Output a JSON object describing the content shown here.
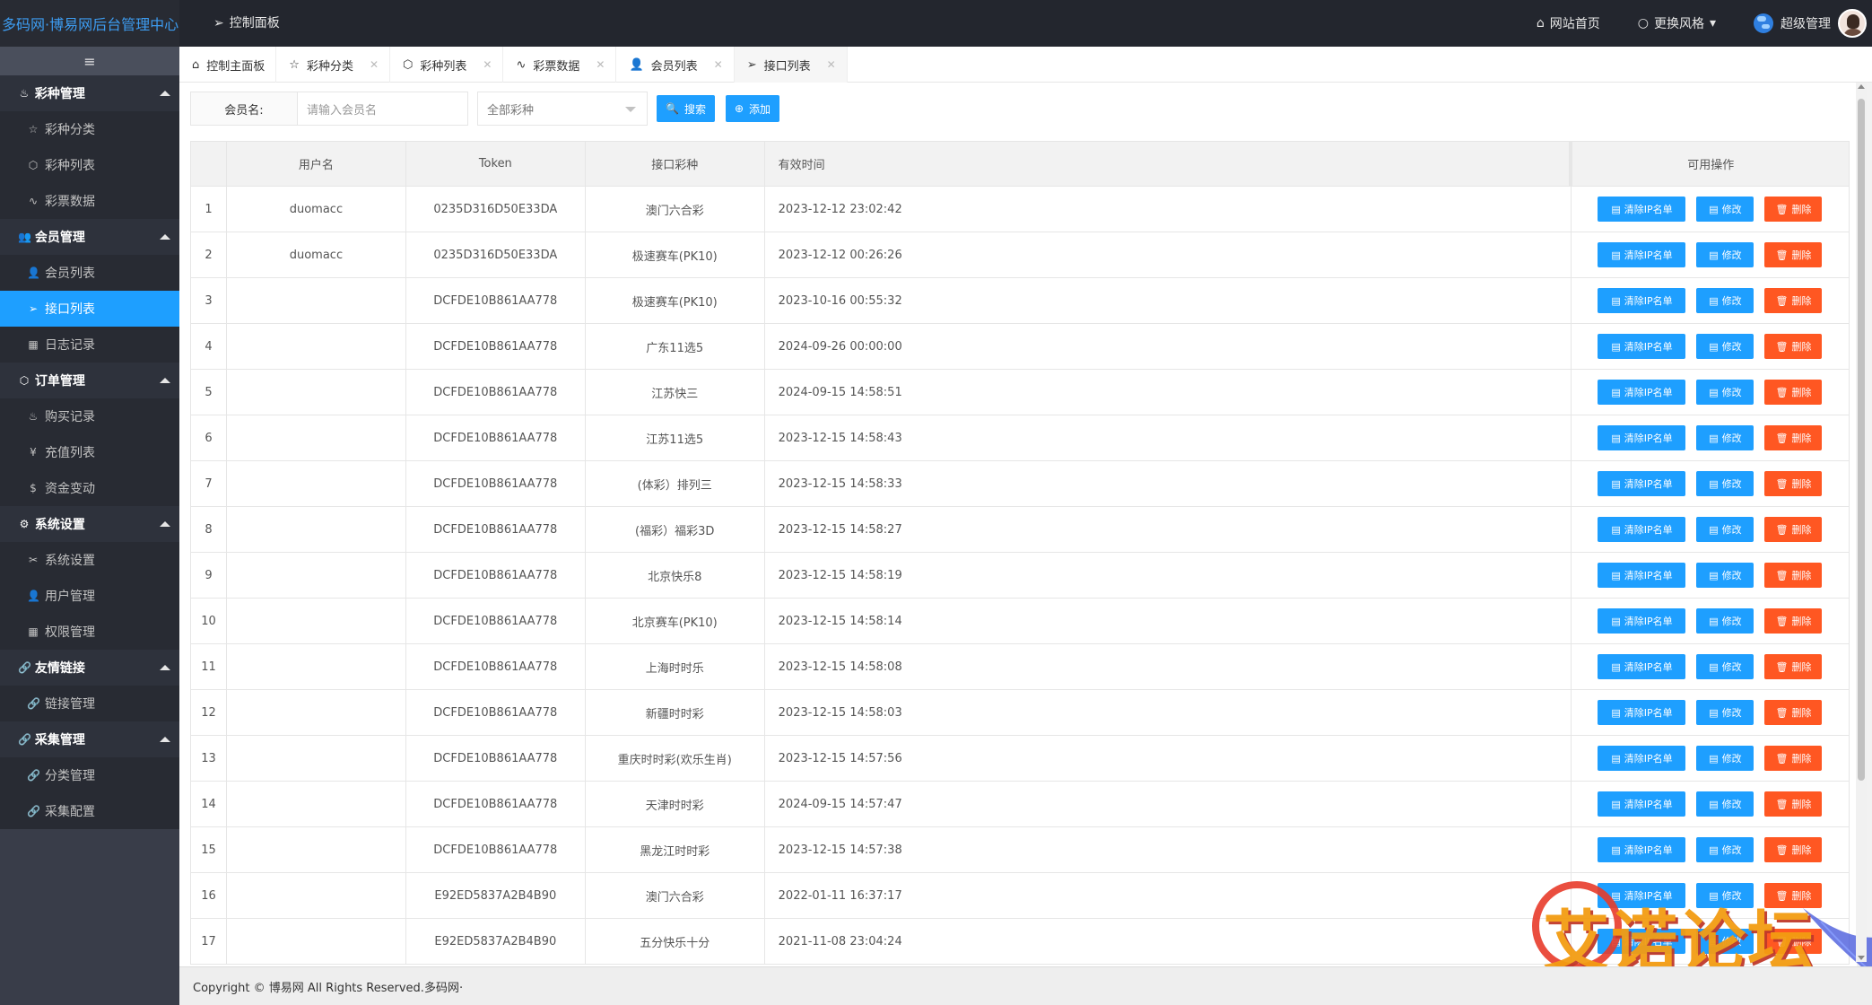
{
  "app": {
    "brand": "多码网·博易网后台管理中心",
    "top_nav": "控制面板",
    "site_home": "网站首页",
    "theme": "更换风格",
    "user": "超级管理"
  },
  "sidebar": {
    "groups": [
      {
        "label": "彩种管理",
        "items": [
          "彩种分类",
          "彩种列表",
          "彩票数据"
        ]
      },
      {
        "label": "会员管理",
        "items": [
          "会员列表",
          "接口列表",
          "日志记录"
        ]
      },
      {
        "label": "订单管理",
        "items": [
          "购买记录",
          "充值列表",
          "资金变动"
        ]
      },
      {
        "label": "系统设置",
        "items": [
          "系统设置",
          "用户管理",
          "权限管理"
        ]
      },
      {
        "label": "友情链接",
        "items": [
          "链接管理"
        ]
      },
      {
        "label": "采集管理",
        "items": [
          "分类管理",
          "采集配置"
        ]
      }
    ]
  },
  "tabs": [
    "控制主面板",
    "彩种分类",
    "彩种列表",
    "彩票数据",
    "会员列表",
    "接口列表"
  ],
  "filters": {
    "member_label": "会员名:",
    "member_placeholder": "请输入会员名",
    "lottery_select": "全部彩种",
    "search": "搜索",
    "add": "添加"
  },
  "table": {
    "headers": [
      "",
      "用户名",
      "Token",
      "接口彩种",
      "有效时间",
      "可用操作"
    ],
    "ops": {
      "clear_ip": "清除IP名单",
      "edit": "修改",
      "delete": "删除"
    },
    "rows": [
      [
        "1",
        "duomacc",
        "0235D316D50E33DA",
        "澳门六合彩",
        "2023-12-12 23:02:42"
      ],
      [
        "2",
        "duomacc",
        "0235D316D50E33DA",
        "极速赛车(PK10)",
        "2023-12-12 00:26:26"
      ],
      [
        "3",
        "",
        "DCFDE10B861AA778",
        "极速赛车(PK10)",
        "2023-10-16 00:55:32"
      ],
      [
        "4",
        "",
        "DCFDE10B861AA778",
        "广东11选5",
        "2024-09-26 00:00:00"
      ],
      [
        "5",
        "",
        "DCFDE10B861AA778",
        "江苏快三",
        "2024-09-15 14:58:51"
      ],
      [
        "6",
        "",
        "DCFDE10B861AA778",
        "江苏11选5",
        "2023-12-15 14:58:43"
      ],
      [
        "7",
        "",
        "DCFDE10B861AA778",
        "(体彩）排列三",
        "2023-12-15 14:58:33"
      ],
      [
        "8",
        "",
        "DCFDE10B861AA778",
        "(福彩）福彩3D",
        "2023-12-15 14:58:27"
      ],
      [
        "9",
        "",
        "DCFDE10B861AA778",
        "北京快乐8",
        "2023-12-15 14:58:19"
      ],
      [
        "10",
        "",
        "DCFDE10B861AA778",
        "北京赛车(PK10)",
        "2023-12-15 14:58:14"
      ],
      [
        "11",
        "",
        "DCFDE10B861AA778",
        "上海时时乐",
        "2023-12-15 14:58:08"
      ],
      [
        "12",
        "",
        "DCFDE10B861AA778",
        "新疆时时彩",
        "2023-12-15 14:58:03"
      ],
      [
        "13",
        "",
        "DCFDE10B861AA778",
        "重庆时时彩(欢乐生肖)",
        "2023-12-15 14:57:56"
      ],
      [
        "14",
        "",
        "DCFDE10B861AA778",
        "天津时时彩",
        "2024-09-15 14:57:47"
      ],
      [
        "15",
        "",
        "DCFDE10B861AA778",
        "黑龙江时时彩",
        "2023-12-15 14:57:38"
      ],
      [
        "16",
        "",
        "E92ED5837A2B4B90",
        "澳门六合彩",
        "2022-01-11 16:37:17"
      ],
      [
        "17",
        "",
        "E92ED5837A2B4B90",
        "五分快乐十分",
        "2021-11-08 23:04:24"
      ]
    ]
  },
  "footer": "Copyright © 博易网 All Rights Reserved.多码网·",
  "watermark": {
    "text": "艾诺论坛",
    "url": "ainuo.it.com"
  },
  "colors": {
    "primary": "#1e9fff",
    "danger": "#ff5722",
    "sidebar_bg": "#393d49",
    "topbar_bg": "#23262e"
  }
}
